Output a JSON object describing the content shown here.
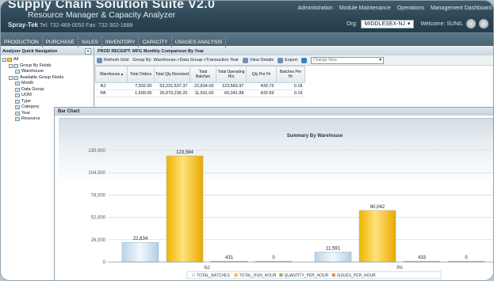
{
  "header": {
    "app_title": "Supply Chain Solution Suite V2.0",
    "app_subtitle": "Resource Manager & Capacity Analyzer",
    "company": "Spray-Tek",
    "company_contact": "Tel: 732-469-0050  Fax: 732-302-1888",
    "top_links": [
      "Administration",
      "Module Maintenance",
      "Operations",
      "Management Dashboard"
    ],
    "org_label": "Org:",
    "org_value": "MIDDLESEX-NJ",
    "welcome": "Welcome: SUNIL"
  },
  "nav": {
    "items": [
      "PRODUCTION",
      "PURCHASE",
      "SALES",
      "INVENTORY",
      "CAPACITY",
      "USAGES ANALYSIS"
    ]
  },
  "left_panel": {
    "title": "Analyzer Quick Navigation",
    "collapse": "«",
    "tree": [
      {
        "label": "All",
        "level": 0,
        "type": "folder",
        "toggle": "-"
      },
      {
        "label": "Group By Fields",
        "level": 1,
        "type": "node",
        "toggle": "-"
      },
      {
        "label": "Warehouse",
        "level": 2,
        "type": "item"
      },
      {
        "label": "Available Group Fields",
        "level": 1,
        "type": "node",
        "toggle": "-"
      },
      {
        "label": "Month",
        "level": 2,
        "type": "item"
      },
      {
        "label": "Data Group",
        "level": 2,
        "type": "item"
      },
      {
        "label": "UOM",
        "level": 2,
        "type": "item"
      },
      {
        "label": "Type",
        "level": 2,
        "type": "item"
      },
      {
        "label": "Category",
        "level": 2,
        "type": "item"
      },
      {
        "label": "Year",
        "level": 2,
        "type": "item"
      },
      {
        "label": "Resource",
        "level": 2,
        "type": "item"
      }
    ]
  },
  "report": {
    "title": "PROD RECEIPT: MFG Monthly Comparison By Year",
    "toolbar": {
      "refresh": "Refresh Grid",
      "group_by": "Group By: Warehouse->Data Group->Transaction Year",
      "view_details": "View Details",
      "export": "Export",
      "view_placeholder": "Change View"
    },
    "columns": [
      "Warehouse",
      "Total Orders",
      "Total Qty Received",
      "Total Batches",
      "Total Operating Hrs",
      "Qty Per Hr",
      "Batches Per Hr"
    ],
    "rows": [
      [
        "NJ",
        "7,932.00",
        "53,231,537.37",
        "22,834.00",
        "123,583.97",
        "430.73",
        "0.18"
      ],
      [
        "PA",
        "1,600.00",
        "25,979,236.20",
        "11,591.00",
        "60,041.88",
        "432.69",
        "0.19"
      ]
    ]
  },
  "chart_window": {
    "title": "Bar Chart"
  },
  "chart_data": {
    "type": "bar",
    "title": "Summary By Warehouse",
    "categories": [
      "NJ",
      "PA"
    ],
    "ylim": [
      0,
      130000
    ],
    "yticks": [
      "0",
      "26,000",
      "52,000",
      "78,000",
      "104,000",
      "130,000"
    ],
    "series": [
      {
        "name": "TOTAL_BATCHES",
        "color": "#cfe3f3",
        "values": [
          22834,
          11591
        ],
        "labels": [
          "22,834",
          "11,591"
        ]
      },
      {
        "name": "TOTAL_RUN_HOUR",
        "color": "#f5c21b",
        "values": [
          123584,
          60042
        ],
        "labels": [
          "123,584",
          "60,042"
        ]
      },
      {
        "name": "QUANTITY_PER_HOUR",
        "color": "#8fa85a",
        "values": [
          431,
          433
        ],
        "labels": [
          "431",
          "433"
        ]
      },
      {
        "name": "ISSUES_PER_HOUR",
        "color": "#e08a3a",
        "values": [
          0,
          0
        ],
        "labels": [
          "0",
          "0"
        ]
      }
    ],
    "grid": true,
    "legend": "bottom"
  }
}
